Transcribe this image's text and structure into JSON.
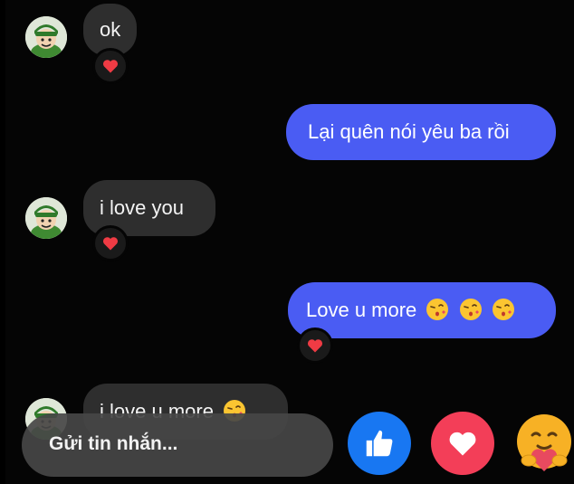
{
  "conversation": {
    "messages": [
      {
        "side": "incoming",
        "text": "ok",
        "reaction": "heart-icon"
      },
      {
        "side": "outgoing",
        "text": "Lại quên nói yêu ba rồi"
      },
      {
        "side": "incoming",
        "text": "i love you",
        "reaction": "heart-icon"
      },
      {
        "side": "outgoing",
        "text": "Love u more",
        "emojis": [
          "kiss-emoji",
          "kiss-emoji",
          "kiss-emoji"
        ],
        "reaction": "heart-icon"
      },
      {
        "side": "incoming",
        "text": "i love u more",
        "emojis": [
          "kiss-emoji"
        ]
      }
    ]
  },
  "composer": {
    "placeholder": "Gửi tin nhắn..."
  },
  "quick_reactions": [
    {
      "name": "like-icon",
      "color": "#1877f2"
    },
    {
      "name": "heart-icon",
      "color": "#f33e58"
    },
    {
      "name": "care-icon",
      "color": "#f7b125"
    }
  ],
  "colors": {
    "outgoing_bubble": "#4a5cf3",
    "incoming_bubble": "#2e2e2e",
    "background": "#050505"
  }
}
